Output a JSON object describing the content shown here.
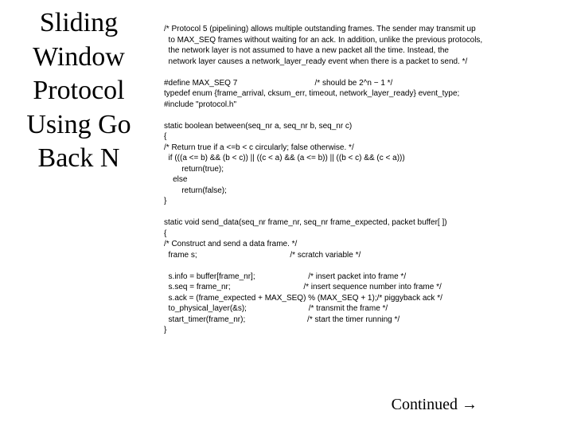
{
  "title": "Sliding Window Protocol Using Go Back N",
  "code_lines": [
    "/* Protocol 5 (pipelining) allows multiple outstanding frames. The sender may transmit up",
    "  to MAX_SEQ frames without waiting for an ack. In addition, unlike the previous protocols,",
    "  the network layer is not assumed to have a new packet all the time. Instead, the",
    "  network layer causes a network_layer_ready event when there is a packet to send. */",
    "",
    "#define MAX_SEQ 7                                   /* should be 2^n − 1 */",
    "typedef enum {frame_arrival, cksum_err, timeout, network_layer_ready} event_type;",
    "#include \"protocol.h\"",
    "",
    "static boolean between(seq_nr a, seq_nr b, seq_nr c)",
    "{",
    "/* Return true if a <=b < c circularly; false otherwise. */",
    "  if (((a <= b) && (b < c)) || ((c < a) && (a <= b)) || ((b < c) && (c < a)))",
    "        return(true);",
    "    else",
    "        return(false);",
    "}",
    "",
    "static void send_data(seq_nr frame_nr, seq_nr frame_expected, packet buffer[ ])",
    "{",
    "/* Construct and send a data frame. */",
    "  frame s;                                          /* scratch variable */",
    "",
    "  s.info = buffer[frame_nr];                        /* insert packet into frame */",
    "  s.seq = frame_nr;                                 /* insert sequence number into frame */",
    "  s.ack = (frame_expected + MAX_SEQ) % (MAX_SEQ + 1);/* piggyback ack */",
    "  to_physical_layer(&s);                            /* transmit the frame */",
    "  start_timer(frame_nr);                            /* start the timer running */",
    "}"
  ],
  "continued": "Continued →"
}
